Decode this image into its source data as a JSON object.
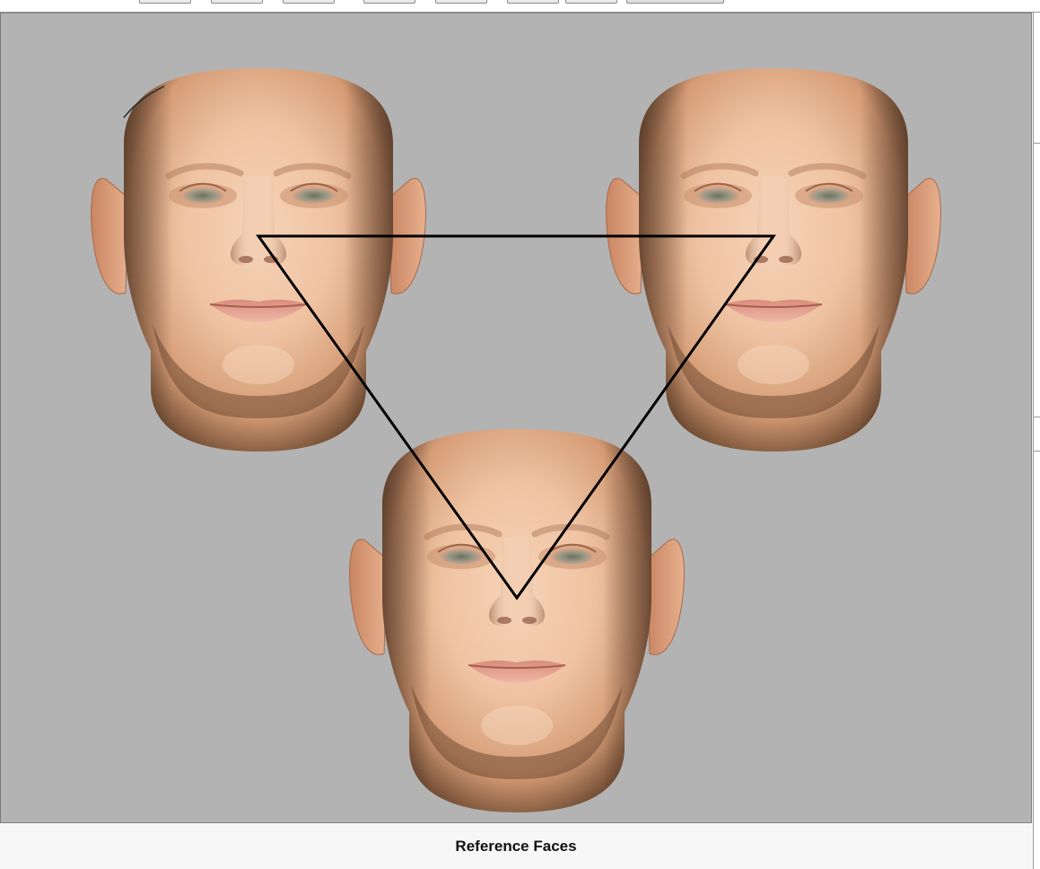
{
  "caption": "Reference Faces",
  "colors": {
    "viewport_background": "#b3b3b3",
    "skin_light": "#f4cdb0",
    "skin_mid": "#e2ab86",
    "skin_dark": "#7a5236",
    "lip": "#e6a79a",
    "iris": "#8a8c78",
    "triangle_stroke": "#000000"
  },
  "faces": [
    {
      "name": "reference-face-top-left"
    },
    {
      "name": "reference-face-top-right"
    },
    {
      "name": "reference-face-bottom"
    }
  ]
}
